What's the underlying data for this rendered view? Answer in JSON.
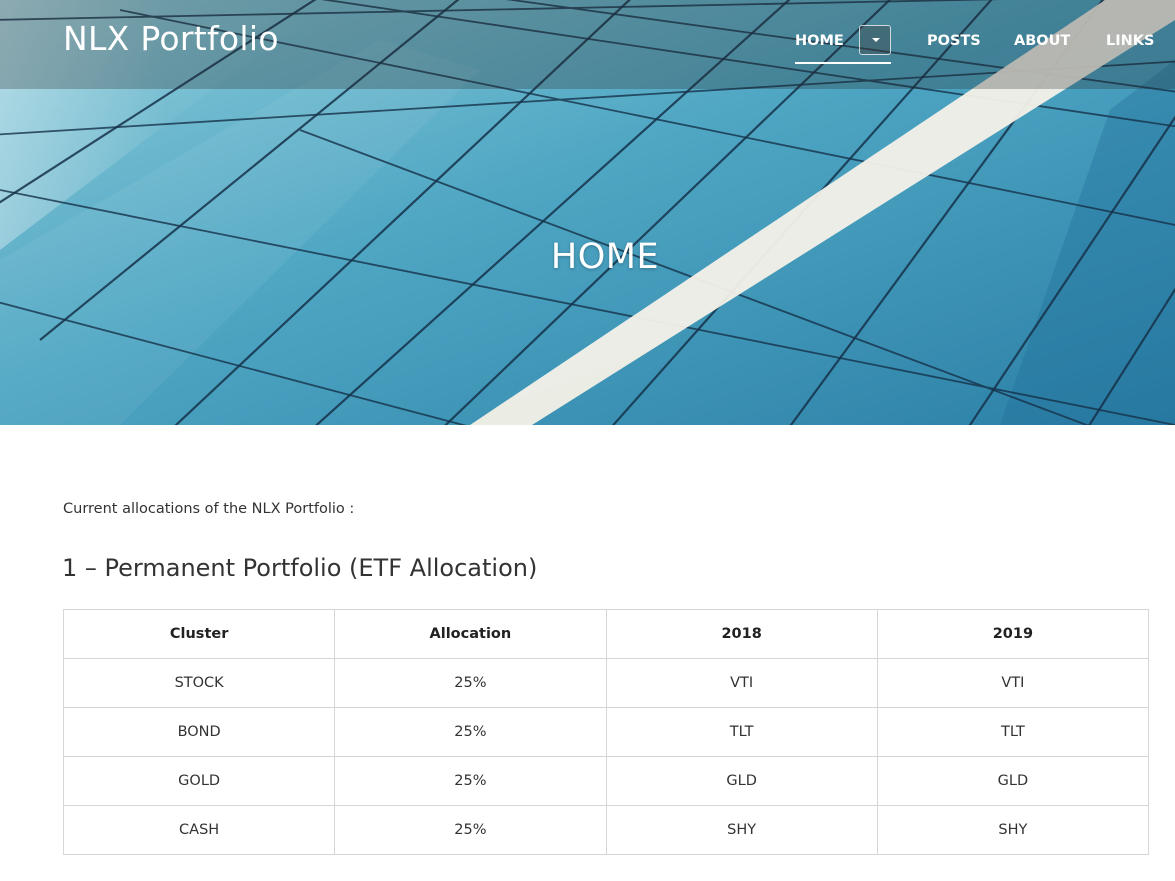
{
  "site": {
    "title": "NLX Portfolio"
  },
  "nav": {
    "items": [
      {
        "label": "HOME",
        "active": true
      },
      {
        "label": "POSTS",
        "active": false
      },
      {
        "label": "ABOUT",
        "active": false
      },
      {
        "label": "LINKS",
        "active": false
      }
    ]
  },
  "hero": {
    "title": "HOME"
  },
  "main": {
    "intro": "Current allocations of the NLX Portfolio :",
    "section_heading": "1 – Permanent Portfolio (ETF Allocation)",
    "table": {
      "headers": [
        "Cluster",
        "Allocation",
        "2018",
        "2019"
      ],
      "rows": [
        [
          "STOCK",
          "25%",
          "VTI",
          "VTI"
        ],
        [
          "BOND",
          "25%",
          "TLT",
          "TLT"
        ],
        [
          "GOLD",
          "25%",
          "GLD",
          "GLD"
        ],
        [
          "CASH",
          "25%",
          "SHY",
          "SHY"
        ]
      ]
    }
  },
  "colors": {
    "hero_blue": "#3f98b8",
    "text": "#333333",
    "border": "#d6d6d6"
  },
  "icons": {
    "dropdown": "caret-down-icon"
  }
}
